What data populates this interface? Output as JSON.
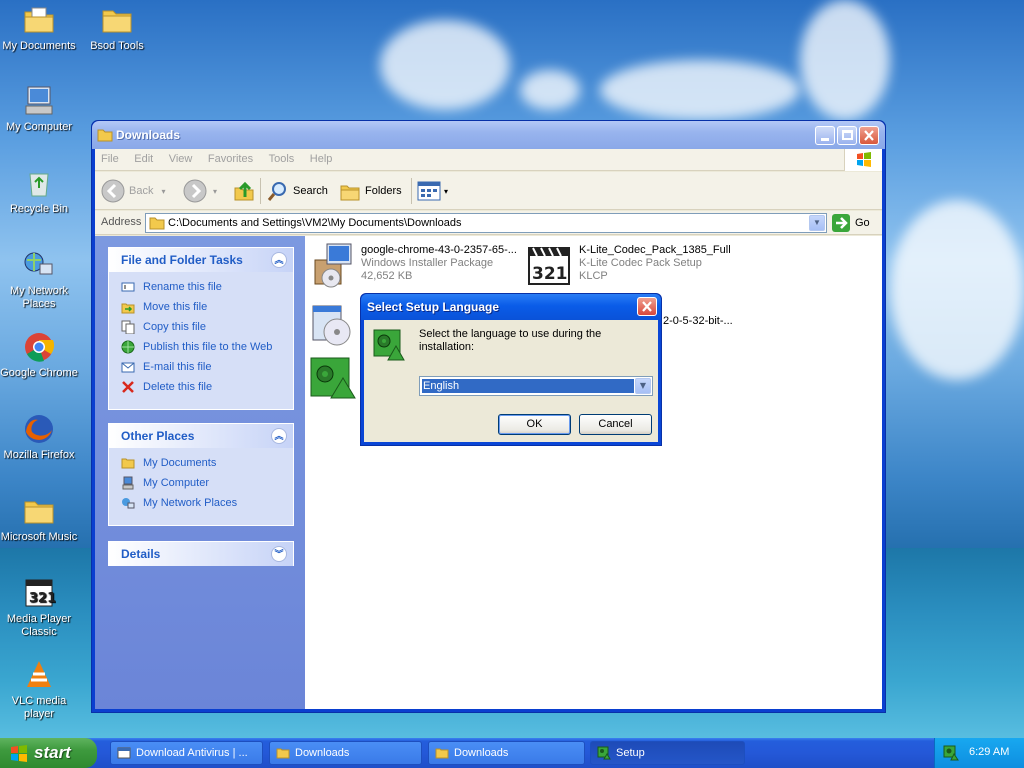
{
  "desktop": {
    "icons": [
      {
        "label": "My Documents",
        "icon": "folder-documents-icon"
      },
      {
        "label": "Bsod Tools",
        "icon": "folder-icon"
      },
      {
        "label": "My Computer",
        "icon": "computer-icon"
      },
      {
        "label": "Recycle Bin",
        "icon": "recycle-bin-icon"
      },
      {
        "label": "My Network Places",
        "icon": "network-icon"
      },
      {
        "label": "Google Chrome",
        "icon": "chrome-icon"
      },
      {
        "label": "Mozilla Firefox",
        "icon": "firefox-icon"
      },
      {
        "label": "Microsoft Music",
        "icon": "folder-icon"
      },
      {
        "label": "Media Player Classic",
        "icon": "media-player-classic-icon"
      },
      {
        "label": "VLC media player",
        "icon": "vlc-icon"
      }
    ]
  },
  "window": {
    "title": "Downloads",
    "menu": [
      "File",
      "Edit",
      "View",
      "Favorites",
      "Tools",
      "Help"
    ],
    "toolbar": {
      "back": "Back",
      "search": "Search",
      "folders": "Folders"
    },
    "address": {
      "label": "Address",
      "value": "C:\\Documents and Settings\\VM2\\My Documents\\Downloads",
      "go": "Go"
    },
    "file_tasks": {
      "title": "File and Folder Tasks",
      "items": [
        "Rename this file",
        "Move this file",
        "Copy this file",
        "Publish this file to the Web",
        "E-mail this file",
        "Delete this file"
      ]
    },
    "other_places": {
      "title": "Other Places",
      "items": [
        "My Documents",
        "My Computer",
        "My Network Places"
      ]
    },
    "details": {
      "title": "Details"
    },
    "files": [
      {
        "name": "google-chrome-43-0-2357-65-...",
        "type": "Windows Installer Package",
        "size": "42,652 KB"
      },
      {
        "name": "K-Lite_Codec_Pack_1385_Full",
        "type": "K-Lite Codec Pack Setup",
        "size": "KLCP"
      },
      {
        "name": "2-0-5-32-bit-..."
      }
    ]
  },
  "dialog": {
    "title": "Select Setup Language",
    "message": "Select the language to use during the installation:",
    "selected": "English",
    "ok": "OK",
    "cancel": "Cancel"
  },
  "taskbar": {
    "start": "start",
    "tasks": [
      "Download Antivirus | ...",
      "Downloads",
      "Downloads",
      "Setup"
    ],
    "clock": "6:29 AM"
  }
}
